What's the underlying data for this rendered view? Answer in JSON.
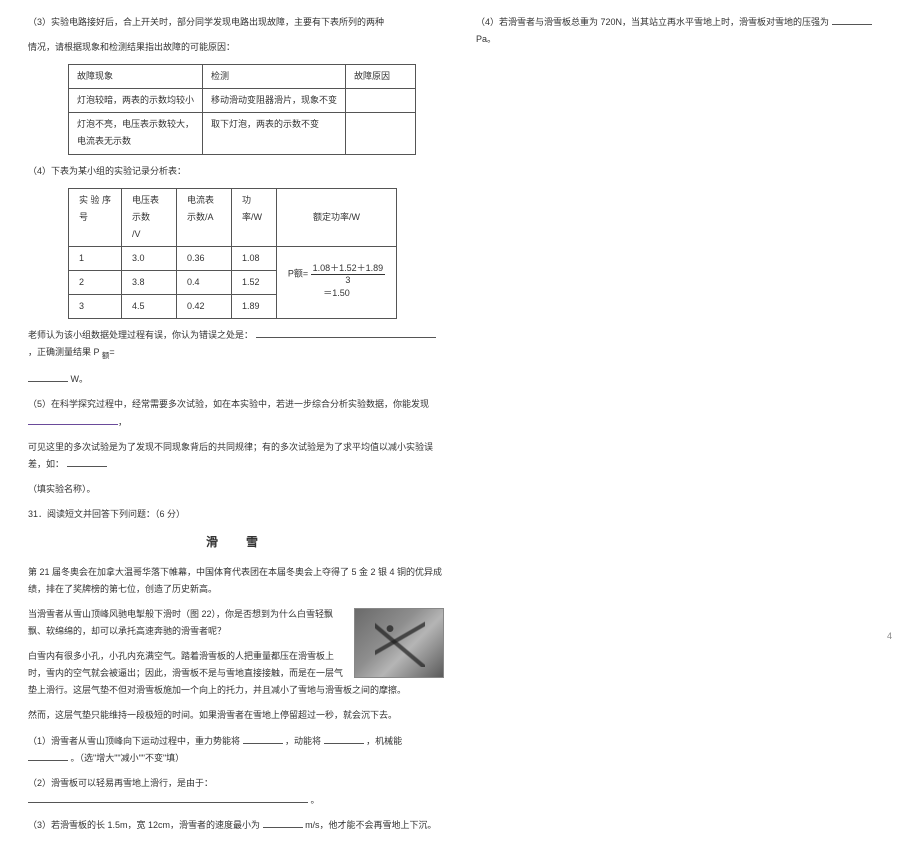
{
  "left": {
    "p3a": "（3）实验电路接好后，合上开关时，部分同学发现电路出现故障，主要有下表所列的两种",
    "p3b": "情况，请根据现象和检测结果指出故障的可能原因：",
    "table1": {
      "h1": "故障现象",
      "h2": "检测",
      "h3": "故障原因",
      "r1c1": "灯泡较暗，两表的示数均较小",
      "r1c2": "移动滑动变阻器滑片，现象不变",
      "r1c3": "",
      "r2c1a": "灯泡不亮，电压表示数较大，",
      "r2c1b": "电流表无示数",
      "r2c2": "取下灯泡，两表的示数不变",
      "r2c3": ""
    },
    "p4": "（4）下表为某小组的实验记录分析表：",
    "table2": {
      "h_seq_a": "实 验 序",
      "h_seq_b": "号",
      "h_v_a": "电压表示数",
      "h_v_b": "/V",
      "h_a": "电流表示数/A",
      "h_p": "功率/W",
      "h_rate": "额定功率/W",
      "r1": {
        "n": "1",
        "v": "3.0",
        "a": "0.36",
        "p": "1.08"
      },
      "r2": {
        "n": "2",
        "v": "3.8",
        "a": "0.4",
        "p": "1.52"
      },
      "r3": {
        "n": "3",
        "v": "4.5",
        "a": "0.42",
        "p": "1.89"
      },
      "frac_prefix": "P额=",
      "frac_top": "1.08＋1.52＋1.89",
      "frac_bot": "3",
      "frac_eq": "＝1.50"
    },
    "p4b_a": "老师认为该小组数据处理过程有误，你认为错误之处是：",
    "p4b_b": "，正确测量结果 P ",
    "p4b_sub": "额",
    "p4b_c": "=",
    "p4c": "W。",
    "p5a": "（5）在科学探究过程中，经常需要多次试验，如在本实验中，若进一步综合分析实验数据，你能发现",
    "p5b": "可见这里的多次试验是为了发现不同现象背后的共同规律；有的多次试验是为了求平均值以减小实验误差，如：",
    "p5c": "（填实验名称）。",
    "q31": "31．阅读短文并回答下列问题：（6 分）",
    "title": "滑　雪",
    "pg1": "第 21 届冬奥会在加拿大温哥华落下帷幕，中国体育代表团在本届冬奥会上夺得了 5 金 2 银 4 铜的优异成绩，排在了奖牌榜的第七位，创造了历史新高。",
    "pg2": "当滑雪者从雪山顶峰风驰电掣般下滑时（图 22），你是否想到为什么白雪轻飘飘、软绵绵的，却可以承托高速奔驰的滑雪者呢？",
    "pg3": "白雪内有很多小孔，小孔内充满空气。踏着滑雪板的人把重量都压在滑雪板上时，雪内的空气就会被逼出；因此，滑雪板不是与雪地直接接触，而是在一层气垫上滑行。这层气垫不但对滑雪板施加一个向上的托力，并且减小了雪地与滑雪板之间的摩擦。",
    "pg4": "然而，这层气垫只能维持一段极短的时间。如果滑雪者在雪地上停留超过一秒，就会沉下去。",
    "sub1_a": "（1）滑雪者从雪山顶峰向下运动过程中，重力势能将",
    "sub1_b": "，动能将",
    "sub1_c": "，机械能",
    "sub1_d": "。（选\"增大\"\"减小\"\"不变\"填）",
    "sub2_a": "（2）滑雪板可以轻易再雪地上滑行，是由于：",
    "sub2_b": "。",
    "sub3_a": "（3）若滑雪板的长 1.5m，宽 12cm，滑雪者的速度最小为",
    "sub3_b": "m/s，他才能不会再雪地上下沉。"
  },
  "right": {
    "p4_a": "（4）若滑雪者与滑雪板总重为 720N，当其站立再水平雪地上时，滑雪板对雪地的压强为",
    "p4_b": "Pa。"
  },
  "pagenum": "4"
}
